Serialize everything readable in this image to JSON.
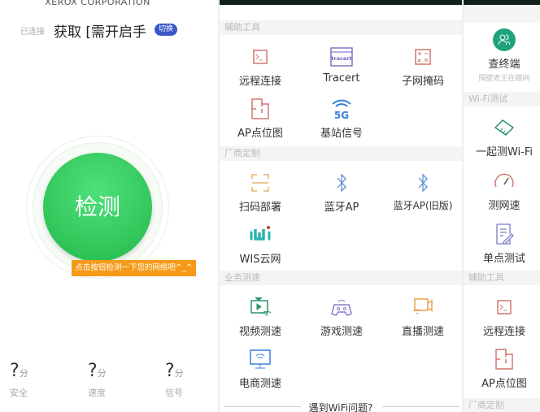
{
  "left": {
    "company": "XEROX CORPORATION",
    "connected_label": "已连接",
    "ssid": "获取 [需开启手",
    "switch_label": "切换",
    "detect_label": "检测",
    "tip": "点击按钮检测一下您的网络吧^_^",
    "stats": [
      {
        "value": "?",
        "unit": "分",
        "label": "安全"
      },
      {
        "value": "?",
        "unit": "分",
        "label": "速度"
      },
      {
        "value": "?",
        "unit": "分",
        "label": "信号"
      }
    ],
    "accent": "#2ecc5a",
    "tip_color": "#f59a18"
  },
  "middle": {
    "sections": [
      {
        "title": "辅助工具",
        "items": [
          {
            "label": "远程连接",
            "icon": "terminal-icon"
          },
          {
            "label": "Tracert",
            "icon": "tracert-icon"
          },
          {
            "label": "子网掩码",
            "icon": "calculator-icon"
          },
          {
            "label": "AP点位图",
            "icon": "floorplan-icon"
          },
          {
            "label": "基站信号",
            "icon": "5g-signal-icon"
          }
        ]
      },
      {
        "title": "厂商定制",
        "items": [
          {
            "label": "扫码部署",
            "icon": "scan-icon"
          },
          {
            "label": "蓝牙AP",
            "icon": "bluetooth-icon"
          },
          {
            "label": "蓝牙AP(旧版)",
            "icon": "bluetooth-icon"
          },
          {
            "label": "WIS云网",
            "icon": "wis-logo-icon"
          }
        ]
      },
      {
        "title": "业务测速",
        "items": [
          {
            "label": "视频测速",
            "icon": "tv-icon"
          },
          {
            "label": "游戏测速",
            "icon": "gamepad-icon"
          },
          {
            "label": "直播测速",
            "icon": "camera-icon"
          },
          {
            "label": "电商测速",
            "icon": "monitor-icon"
          }
        ]
      }
    ],
    "footer": "遇到WiFi问题?"
  },
  "right": {
    "terminal_label": "查终端",
    "terminal_sub": "隔壁老王在蹭网",
    "sections": [
      {
        "title": "Wi-Fi测试",
        "items": [
          {
            "label": "一起测Wi-Fi",
            "icon": "handshake-icon"
          },
          {
            "label": "测网速",
            "icon": "speedometer-icon"
          },
          {
            "label": "单点测试",
            "icon": "edit-doc-icon"
          }
        ]
      },
      {
        "title": "辅助工具",
        "items": [
          {
            "label": "远程连接",
            "icon": "terminal-icon"
          },
          {
            "label": "AP点位图",
            "icon": "floorplan-icon"
          }
        ]
      },
      {
        "title": "厂商定制",
        "items": []
      }
    ]
  }
}
